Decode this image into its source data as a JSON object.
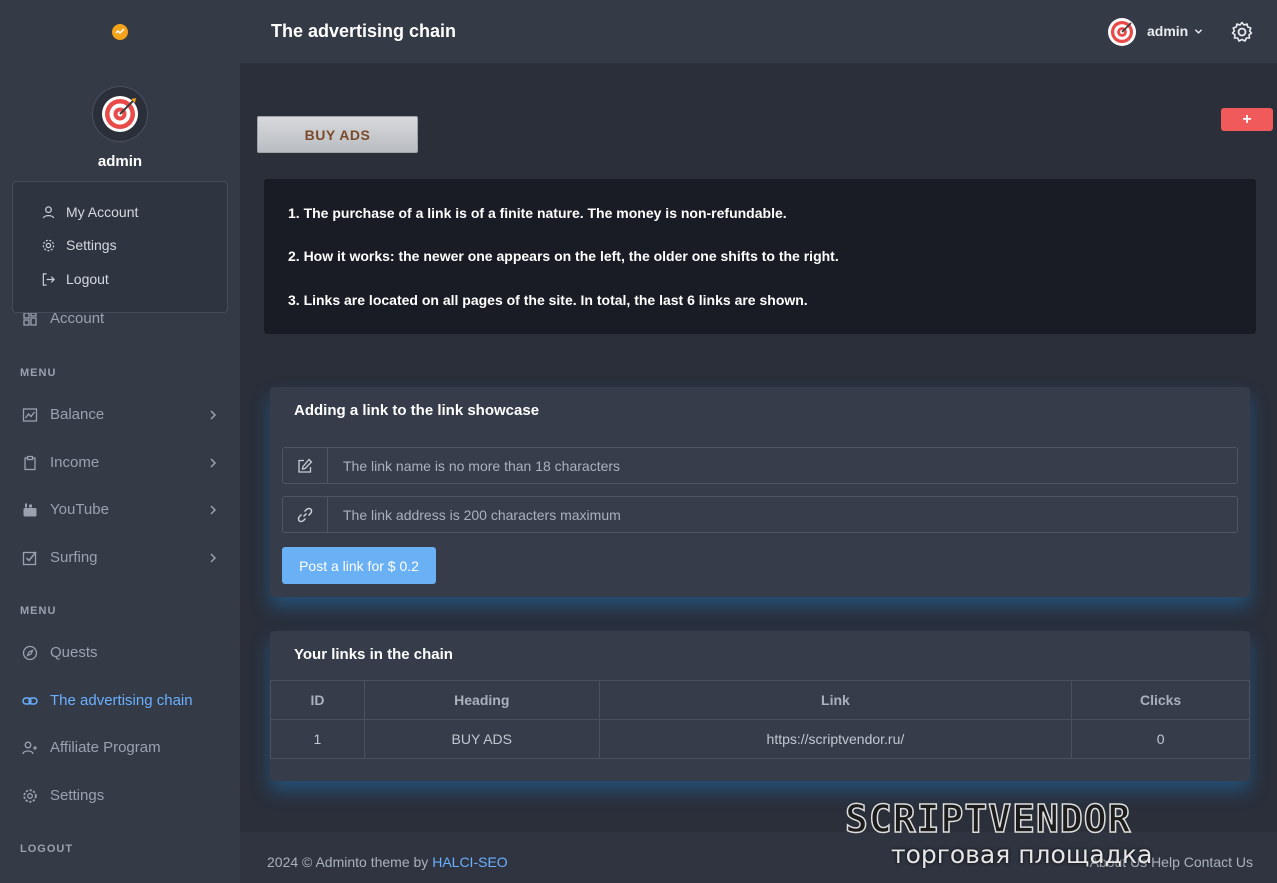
{
  "app": {
    "title": "The advertising chain"
  },
  "header": {
    "user": "admin"
  },
  "sidebar": {
    "user_name": "admin",
    "dropdown": [
      "My Account",
      "Settings",
      "Logout"
    ],
    "account_label": "Account",
    "menu1_head": "MENU",
    "menu1": [
      "Balance",
      "Income",
      "YouTube",
      "Surfing"
    ],
    "menu2_head": "MENU",
    "menu2": [
      "Quests",
      "The advertising chain",
      "Affiliate Program",
      "Settings"
    ],
    "logout_head": "LOGOUT",
    "active_color": "#6ab0ff"
  },
  "main": {
    "buy_label": "BUY ADS",
    "plus_label": "+",
    "rules": [
      "1. The purchase of a link is of a finite nature. The money is non-refundable.",
      "2. How it works: the newer one appears on the left, the older one shifts to the right.",
      "3. Links are located on all pages of the site. In total, the last 6 links are shown."
    ],
    "form": {
      "title": "Adding a link to the link showcase",
      "name_placeholder": "The link name is no more than 18 characters",
      "address_placeholder": "The link address is 200 characters maximum",
      "submit_label": "Post a link for $ 0.2"
    },
    "links": {
      "title": "Your links in the chain",
      "columns": [
        "ID",
        "Heading",
        "Link",
        "Clicks"
      ],
      "rows": [
        [
          "1",
          "BUY ADS",
          "https://scriptvendor.ru/",
          "0"
        ]
      ]
    }
  },
  "footer": {
    "text": "2024 © Adminto theme by ",
    "link": "HALCI-SEO",
    "right": "About Us  Help  Contact Us"
  },
  "watermark": {
    "top": "SCRIPTVENDOR",
    "bottom": "торговая площадка"
  }
}
